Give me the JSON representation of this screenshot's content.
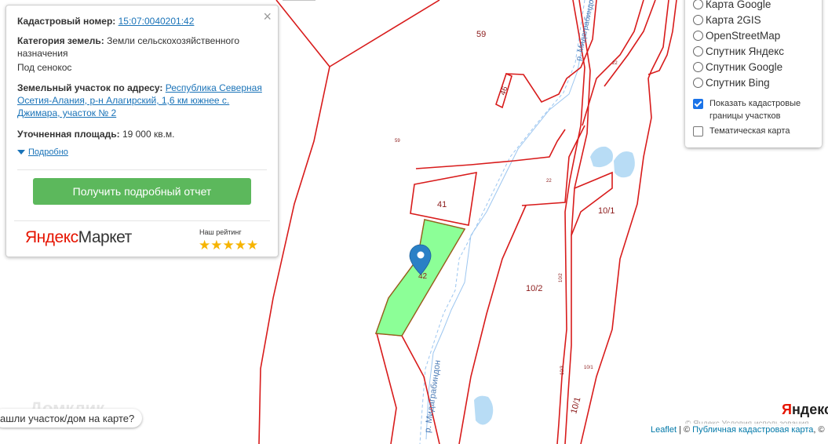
{
  "info": {
    "cadastral_label": "Кадастровый номер:",
    "cadastral_value": "15:07:0040201:42",
    "category_label": "Категория земель:",
    "category_value": "Земли сельскохозяйственного назначения",
    "use_value": "Под сенокос",
    "address_label": "Земельный участок по адресу:",
    "address_value": "Республика Северная Осетия-Алания, р-н Алагирский, 1,6 км южнее с. Джимара, участок № 2",
    "area_label": "Уточненная площадь:",
    "area_value": "19 000 кв.м.",
    "details_link": "Подробно",
    "report_button": "Получить подробный отчет",
    "close_icon": "×",
    "market_logo_1": "Яндекс",
    "market_logo_2": "Маркет",
    "rating_label": "Наш рейтинг",
    "stars": "★★★★★"
  },
  "layers": {
    "options": [
      "Карта Google",
      "Карта 2GIS",
      "OpenStreetMap",
      "Спутник Яндекс",
      "Спутник Google",
      "Спутник Bing"
    ],
    "show_cadastral": "Показать кадастровые границы участков",
    "show_cadastral_checked": true,
    "thematic": "Тематическая карта",
    "thematic_checked": false
  },
  "map": {
    "parcels": [
      "59",
      "46",
      "41",
      "42",
      "10/1",
      "10/2",
      "22",
      "59"
    ],
    "river_name": "р. Мидаграбиндон",
    "small_labels": [
      "22",
      "22",
      "10/2",
      "10/3",
      "10/1"
    ],
    "marker_icon": "map-pin-icon",
    "highlight_color": "#7fff8c",
    "boundary_color": "#d81b1b"
  },
  "bottom": {
    "question": "ашли участок/дом на карте?",
    "watermark": "Домклик",
    "yandex_logo_y": "Я",
    "yandex_logo_rest": "ндекс",
    "terms": "© Яндекс  Условия использования",
    "leaflet": "Leaflet",
    "separator": " | © ",
    "pkk": "Публичная кадастровая карта",
    "trailing": ", ©"
  }
}
